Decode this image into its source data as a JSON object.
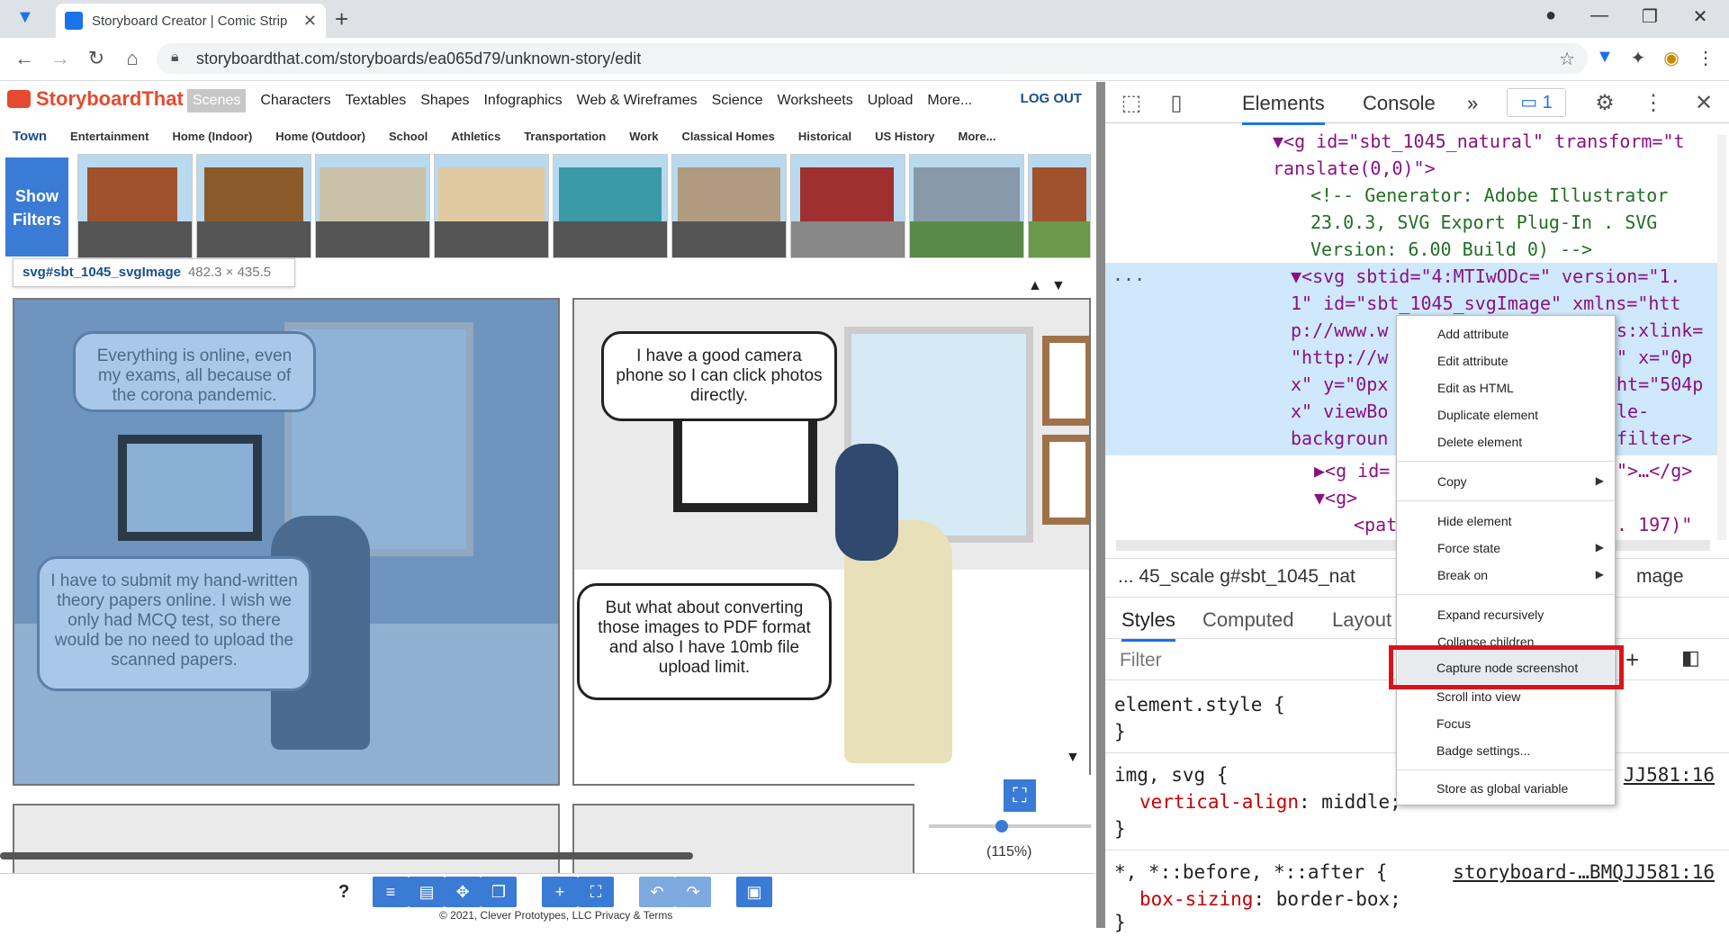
{
  "browser": {
    "tab_title": "Storyboard Creator | Comic Strip",
    "url": "storyboardthat.com/storyboards/ea065d79/unknown-story/edit"
  },
  "site": {
    "logo": "StoryboardThat",
    "nav": [
      "Scenes",
      "Characters",
      "Textables",
      "Shapes",
      "Infographics",
      "Web & Wireframes",
      "Science",
      "Worksheets",
      "Upload",
      "More..."
    ],
    "logout": "LOG OUT",
    "subnav": [
      "Town",
      "Entertainment",
      "Home (Indoor)",
      "Home (Outdoor)",
      "School",
      "Athletics",
      "Transportation",
      "Work",
      "Classical Homes",
      "Historical",
      "US History",
      "More..."
    ],
    "show_filters": "Show Filters",
    "tooltip": {
      "selector": "svg#sbt_1045_svgImage",
      "dims": "482.3 × 435.5"
    },
    "panel1_bubble1": "Everything is online, even my exams, all because of the corona pandemic.",
    "panel1_bubble2": "I have to submit my hand-written theory papers online. I wish we only had MCQ test, so there would be no need to upload the scanned papers.",
    "panel2_bubble1": "I have a good camera phone so I can click photos directly.",
    "panel2_bubble2": "But what about converting those images to PDF format and also I have 10mb file upload limit.",
    "zoom": "(115%)",
    "zoom_level_percent": 115,
    "question": "?",
    "footer": "© 2021, Clever Prototypes, LLC Privacy & Terms"
  },
  "devtools": {
    "tabs": {
      "elements": "Elements",
      "console": "Console",
      "more": "»",
      "issues": "1"
    },
    "dom": {
      "l1": "▼<g id=\"sbt_1045_natural\" transform=\"t",
      "l2": "ranslate(0,0)\">",
      "l3": "<!-- Generator: Adobe Illustrator",
      "l4": "23.0.3, SVG Export Plug-In . SVG",
      "l5": "Version: 6.00 Build 0) -->",
      "l6": "▼<svg sbtid=\"4:MTIwODc=\" version=\"1.",
      "l7": "1\" id=\"sbt_1045_svgImage\" xmlns=\"htt",
      "l8": "p://www.w",
      "l8b": "s:xlink=",
      "l9": "\"http://w",
      "l9b": "\" x=\"0p",
      "l10": "x\" y=\"0px",
      "l10b": "ht=\"504p",
      "l11": "x\" viewBo",
      "l11b": "le-",
      "l12": "backgroun",
      "l12b": "filter>",
      "l13": "▶<g id=",
      "l13b": "\">…</g>",
      "l14": "▼<g>",
      "l15": "<pat",
      "l15b": ". 197)\"",
      "dots": "..."
    },
    "breadcrumbs": "...  45_scale   g#sbt_1045_nat",
    "breadcrumbs_end": "mage",
    "subtabs": [
      "Styles",
      "Computed",
      "Layout"
    ],
    "filter": "Filter",
    "rules": {
      "r1": "element.style {",
      "r1e": "}",
      "r2": "img, svg {",
      "r2src": "JJ581:16",
      "r2p": "vertical-align",
      "r2v": ": middle;",
      "r2e": "}",
      "r3": "*, *::before, *::after {",
      "r3src": "storyboard-…BMQJJ581:16",
      "r3p": "box-sizing",
      "r3v": ": border-box;",
      "r3e": "}"
    }
  },
  "context_menu": {
    "items": [
      "Add attribute",
      "Edit attribute",
      "Edit as HTML",
      "Duplicate element",
      "Delete element",
      "Copy",
      "Hide element",
      "Force state",
      "Break on",
      "Expand recursively",
      "Collapse children",
      "Capture node screenshot",
      "Scroll into view",
      "Focus",
      "Badge settings...",
      "Store as global variable"
    ],
    "highlighted": "Capture node screenshot"
  },
  "colors": {
    "accent": "#1a73e8",
    "highlight_box": "#e0101a",
    "site_blue": "#3a7bd5"
  },
  "icons": [
    "back-icon",
    "forward-icon",
    "reload-icon",
    "home-icon",
    "lock-icon",
    "star-icon",
    "extension-icon",
    "inspect-icon",
    "device-icon",
    "gear-icon",
    "kebab-icon",
    "close-icon"
  ]
}
